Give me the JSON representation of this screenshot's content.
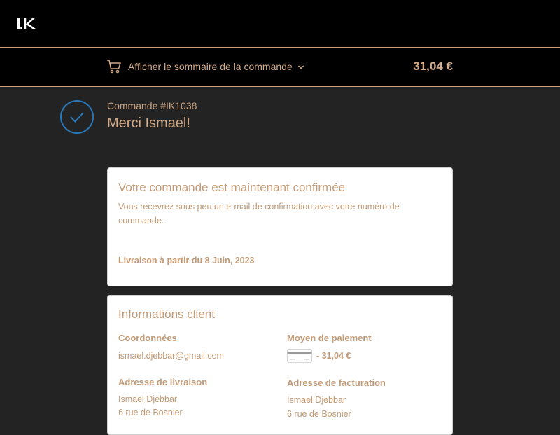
{
  "brand": {
    "logo_icon": "ik-logo-icon"
  },
  "summary": {
    "toggle_label": "Afficher le sommaire de la commande",
    "total": "31,04 €",
    "cart_icon": "cart-icon",
    "chevron_icon": "chevron-down-icon"
  },
  "order": {
    "number": "Commande #IK1038",
    "thanks": "Merci Ismael!",
    "status_icon": "check-circle-icon"
  },
  "confirmation": {
    "title": "Votre commande est maintenant confirmée",
    "message": "Vous recevrez sous peu un e-mail de confirmation avec votre numéro de commande.",
    "delivery": "Livraison à partir du 8 Juin, 2023"
  },
  "customer": {
    "title": "Informations client",
    "contact_label": "Coordonnées",
    "email": "ismael.djebbar@gmail.com",
    "payment_label": "Moyen de paiement",
    "payment_amount": "- 31,04 €",
    "payment_icon": "credit-card-icon",
    "shipping_label": "Adresse de livraison",
    "shipping_name": "Ismael Djebbar",
    "shipping_street": "6 rue de Bosnier",
    "billing_label": "Adresse de facturation",
    "billing_name": "Ismael Djebbar",
    "billing_street": "6 rue de Bosnier"
  },
  "colors": {
    "accent": "#d2aa87",
    "header_bg": "#000000",
    "page_bg": "#232323",
    "check": "#2a78b8"
  }
}
